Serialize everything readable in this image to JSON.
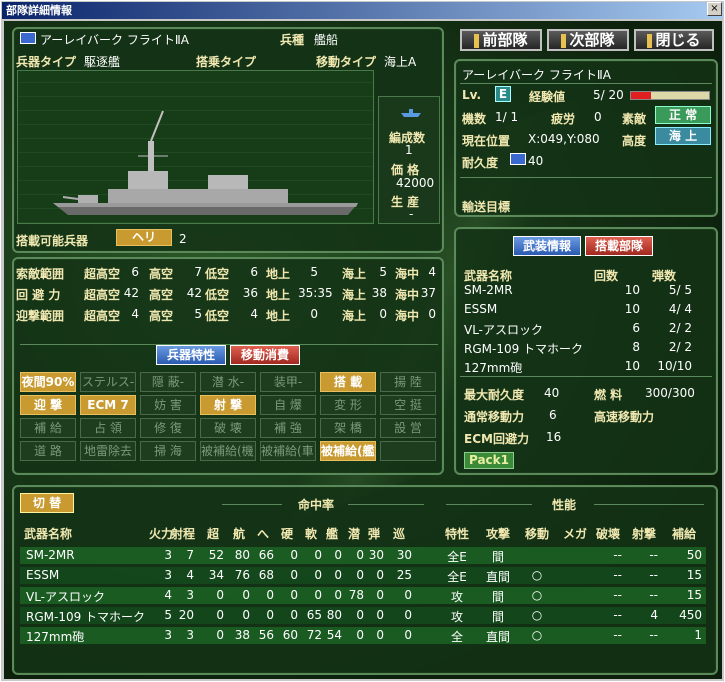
{
  "window": {
    "title": "部隊詳細情報",
    "close": "×"
  },
  "nav": {
    "prev": "前部隊",
    "next": "次部隊",
    "close": "閉じる"
  },
  "unit": {
    "name": "アーレイバーク フライトⅡA",
    "kind_label": "兵種",
    "kind": "艦船",
    "weapon_type_label": "兵器タイプ",
    "weapon_type": "駆逐艦",
    "carry_type_label": "搭乗タイプ",
    "move_type_label": "移動タイプ",
    "move_type": "海上A",
    "formation_label": "編成数",
    "formation": "1",
    "price_label": "価 格",
    "price": "42000",
    "production_label": "生 産",
    "production": "-",
    "carriable_label": "搭載可能兵器",
    "carriable_tag": "ヘリ",
    "carriable_count": "2"
  },
  "ranges": [
    {
      "label": "索敵範囲",
      "cells": [
        "超高空",
        "6",
        "高空",
        "7",
        "低空",
        "6",
        "地上",
        "5",
        "海上",
        "5",
        "海中",
        "4"
      ]
    },
    {
      "label": "回 避 力",
      "cells": [
        "超高空",
        "42",
        "高空",
        "42",
        "低空",
        "36",
        "地上",
        "35:35",
        "海上",
        "38",
        "海中",
        "37"
      ]
    },
    {
      "label": "迎撃範囲",
      "cells": [
        "超高空",
        "4",
        "高空",
        "5",
        "低空",
        "4",
        "地上",
        "0",
        "海上",
        "0",
        "海中",
        "0"
      ]
    }
  ],
  "tabs_left": {
    "traits": "兵器特性",
    "move": "移動消費"
  },
  "traits": [
    [
      "夜間90%",
      "ステルス-",
      "隠 蔽-",
      "潜 水-",
      "装甲-",
      "搭 載",
      "揚 陸"
    ],
    [
      "迎 撃",
      "ECM 7",
      "妨 害",
      "射 撃",
      "自 爆",
      "変 形",
      "空 挺"
    ],
    [
      "補 給",
      "占 領",
      "修 復",
      "破 壊",
      "補 強",
      "架 橋",
      "設 営"
    ],
    [
      "道 路",
      "地雷除去",
      "掃 海",
      "被補給(機)",
      "被補給(車)",
      "被補給(艦)",
      ""
    ]
  ],
  "traits_on": [
    [
      true,
      false,
      false,
      false,
      false,
      true,
      false
    ],
    [
      true,
      true,
      false,
      true,
      false,
      false,
      false
    ],
    [
      false,
      false,
      false,
      false,
      false,
      false,
      false
    ],
    [
      false,
      false,
      false,
      false,
      false,
      true,
      false
    ]
  ],
  "status": {
    "name": "アーレイバーク フライトⅡA",
    "lv_label": "Lv.",
    "lv": "E",
    "exp_label": "経験値",
    "exp": "5/ 20",
    "exp_ratio": 0.25,
    "units_label": "機数",
    "units": "1/ 1",
    "fatigue_label": "疲労",
    "fatigue": "0",
    "morale_label": "素敵",
    "morale": "正 常",
    "pos_label": "現在位置",
    "pos": "X:049,Y:080",
    "alt_label": "高度",
    "alt": "海 上",
    "dur_label": "耐久度",
    "dur": "40",
    "dest_label": "輸送目標"
  },
  "tabs_right": {
    "arms": "武装情報",
    "carried": "搭載部隊"
  },
  "arms_header": {
    "name": "武器名称",
    "times": "回数",
    "ammo": "弾数"
  },
  "arms": [
    {
      "name": "SM-2MR",
      "times": "10",
      "ammo": "5/ 5"
    },
    {
      "name": "ESSM",
      "times": "10",
      "ammo": "4/ 4"
    },
    {
      "name": "VL-アスロック",
      "times": "6",
      "ammo": "2/ 2"
    },
    {
      "name": "RGM-109 トマホーク",
      "times": "8",
      "ammo": "2/ 2"
    },
    {
      "name": "127mm砲",
      "times": "10",
      "ammo": "10/10"
    }
  ],
  "stats": {
    "maxdur_label": "最大耐久度",
    "maxdur": "40",
    "fuel_label": "燃 料",
    "fuel": "300/300",
    "move_label": "通常移動力",
    "move": "6",
    "fastmove_label": "高速移動力",
    "ecm_label": "ECM回避力",
    "ecm": "16",
    "pack": "Pack1"
  },
  "bottom": {
    "switch": "切 替",
    "hit_label": "命中率",
    "perf_label": "性能",
    "headers": [
      "武器名称",
      "火力",
      "射程",
      "超",
      "航",
      "へ",
      "硬",
      "軟",
      "艦",
      "潜",
      "弾",
      "巡",
      "特性",
      "攻撃",
      "移動",
      "メガ",
      "破壊",
      "射撃",
      "補給"
    ],
    "rows": [
      [
        "SM-2MR",
        "3",
        "7",
        "52",
        "80",
        "66",
        "0",
        "0",
        "0",
        "0",
        "30",
        "30",
        "全E",
        "間",
        "",
        "",
        "--",
        "--",
        "50"
      ],
      [
        "ESSM",
        "3",
        "4",
        "34",
        "76",
        "68",
        "0",
        "0",
        "0",
        "0",
        "0",
        "25",
        "全E",
        "直間",
        "○",
        "",
        "--",
        "--",
        "15"
      ],
      [
        "VL-アスロック",
        "4",
        "3",
        "0",
        "0",
        "0",
        "0",
        "0",
        "0",
        "78",
        "0",
        "0",
        "攻",
        "間",
        "○",
        "",
        "--",
        "--",
        "15"
      ],
      [
        "RGM-109 トマホーク",
        "5",
        "20",
        "0",
        "0",
        "0",
        "0",
        "65",
        "80",
        "0",
        "0",
        "0",
        "攻",
        "間",
        "○",
        "",
        "--",
        "4",
        "450"
      ],
      [
        "127mm砲",
        "3",
        "3",
        "0",
        "38",
        "56",
        "60",
        "72",
        "54",
        "0",
        "0",
        "0",
        "全",
        "直間",
        "○",
        "",
        "--",
        "--",
        "1"
      ]
    ]
  },
  "colors": {
    "accent": "#e8c050",
    "bar": "#1e6e28"
  }
}
